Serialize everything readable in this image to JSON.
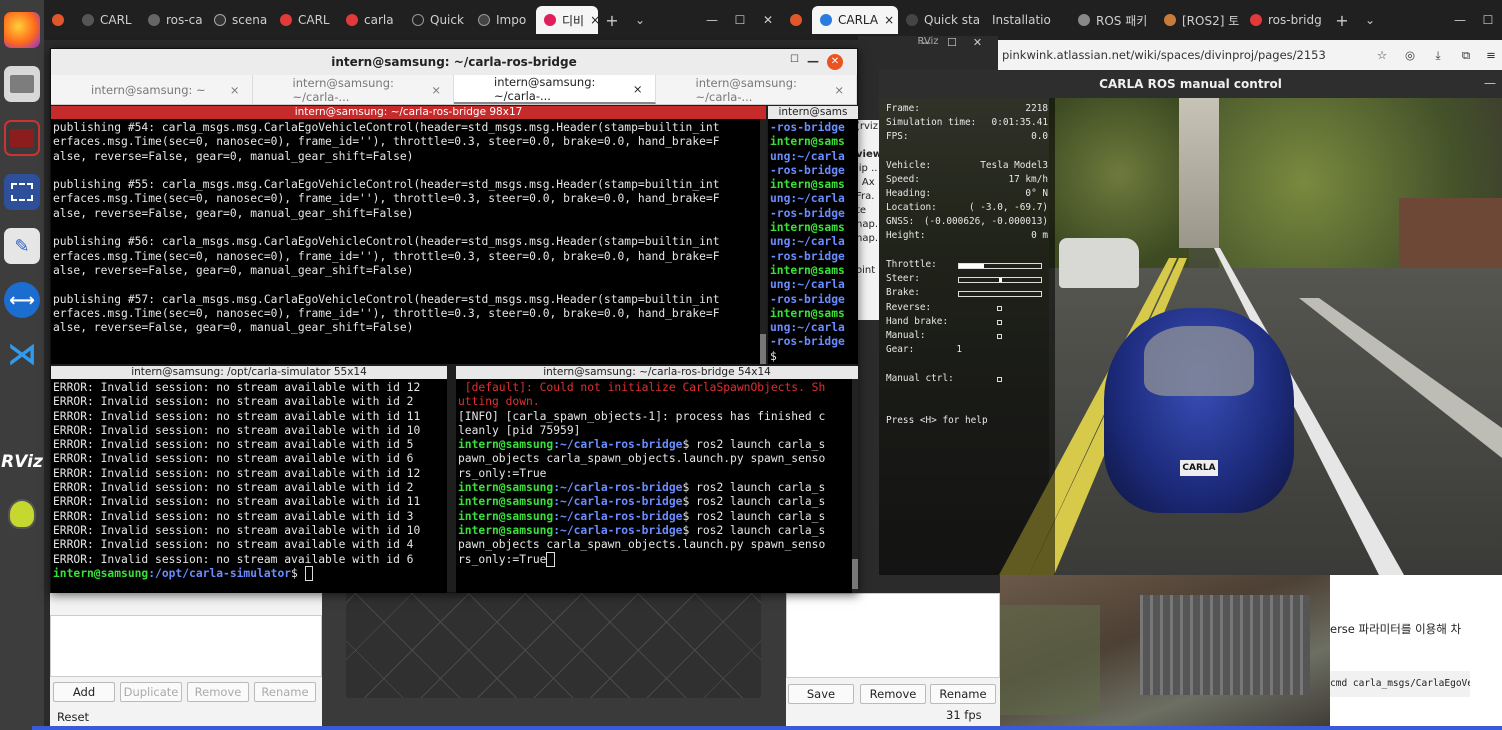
{
  "dock": {
    "items": [
      "firefox-icon",
      "files-icon",
      "terminal-icon",
      "screenshot-icon",
      "text-editor-icon",
      "teamviewer-icon",
      "vscode-icon",
      "rviz-icon",
      "ros-turtle-icon"
    ],
    "rviz_label": "RViz"
  },
  "browser_left": {
    "tabs": [
      "CARL",
      "ros-ca",
      "scena",
      "CARL",
      "carla",
      "Quick",
      "Impo",
      "디비"
    ],
    "add_tab": "+",
    "dropdown": "⌄"
  },
  "browser_right": {
    "tabs": [
      "CARLA",
      "Quick sta",
      "Installatio",
      "ROS 패키",
      "[ROS2] 토",
      "ros-bridg"
    ],
    "add_tab": "+",
    "address": "pinkwink.atlassian.net/wiki/spaces/divinproj/pages/2153",
    "address_host": "pinkwink.atlassian.net",
    "korean_text": "erse 파라미터를 이용해 차",
    "code_snippet": "cmd carla_msgs/CarlaEgoVe"
  },
  "rviz": {
    "title": "RViz",
    "panel_fragments": [
      "(rviz",
      "view",
      "lip ..",
      "' Ax",
      "Fra.",
      "te",
      "hap.",
      "hap.",
      "oint"
    ],
    "buttons_left": {
      "add": "Add",
      "duplicate": "Duplicate",
      "remove": "Remove",
      "rename": "Rename",
      "reset": "Reset"
    },
    "buttons_right": {
      "save": "Save",
      "remove": "Remove",
      "rename": "Rename"
    },
    "fps": "31 fps"
  },
  "terminal": {
    "title": "intern@samsung: ~/carla-ros-bridge",
    "tabs": [
      "intern@samsung: ~",
      "intern@samsung: ~/carla-...",
      "intern@samsung: ~/carla-...",
      "intern@samsung: ~/carla-..."
    ],
    "pane_top_left": {
      "title": "intern@samsung: ~/carla-ros-bridge 98x17",
      "lines": [
        "publishing #54: carla_msgs.msg.CarlaEgoVehicleControl(header=std_msgs.msg.Header(stamp=builtin_int",
        "erfaces.msg.Time(sec=0, nanosec=0), frame_id=''), throttle=0.3, steer=0.0, brake=0.0, hand_brake=F",
        "alse, reverse=False, gear=0, manual_gear_shift=False)",
        "",
        "publishing #55: carla_msgs.msg.CarlaEgoVehicleControl(header=std_msgs.msg.Header(stamp=builtin_int",
        "erfaces.msg.Time(sec=0, nanosec=0), frame_id=''), throttle=0.3, steer=0.0, brake=0.0, hand_brake=F",
        "alse, reverse=False, gear=0, manual_gear_shift=False)",
        "",
        "publishing #56: carla_msgs.msg.CarlaEgoVehicleControl(header=std_msgs.msg.Header(stamp=builtin_int",
        "erfaces.msg.Time(sec=0, nanosec=0), frame_id=''), throttle=0.3, steer=0.0, brake=0.0, hand_brake=F",
        "alse, reverse=False, gear=0, manual_gear_shift=False)",
        "",
        "publishing #57: carla_msgs.msg.CarlaEgoVehicleControl(header=std_msgs.msg.Header(stamp=builtin_int",
        "erfaces.msg.Time(sec=0, nanosec=0), frame_id=''), throttle=0.3, steer=0.0, brake=0.0, hand_brake=F",
        "alse, reverse=False, gear=0, manual_gear_shift=False)"
      ]
    },
    "pane_top_right": {
      "title": "intern@sams",
      "lines": [
        "-ros-bridge",
        "intern@sams",
        "ung:~/carla",
        "-ros-bridge",
        "intern@sams",
        "ung:~/carla",
        "-ros-bridge",
        "intern@sams",
        "ung:~/carla",
        "-ros-bridge",
        "intern@sams",
        "ung:~/carla",
        "-ros-bridge",
        "intern@sams",
        "ung:~/carla",
        "-ros-bridge",
        "$"
      ]
    },
    "pane_bottom_left": {
      "title": "intern@samsung: /opt/carla-simulator 55x14",
      "errors": [
        "ERROR: Invalid session: no stream available with id 12",
        "ERROR: Invalid session: no stream available with id 2",
        "ERROR: Invalid session: no stream available with id 11",
        "ERROR: Invalid session: no stream available with id 10",
        "ERROR: Invalid session: no stream available with id 5",
        "ERROR: Invalid session: no stream available with id 6",
        "ERROR: Invalid session: no stream available with id 12",
        "ERROR: Invalid session: no stream available with id 2",
        "ERROR: Invalid session: no stream available with id 11",
        "ERROR: Invalid session: no stream available with id 3",
        "ERROR: Invalid session: no stream available with id 10",
        "ERROR: Invalid session: no stream available with id 4",
        "ERROR: Invalid session: no stream available with id 6"
      ],
      "prompt_user": "intern@samsung",
      "prompt_path": ":/opt/carla-simulator",
      "prompt_sym": "$ "
    },
    "pane_bottom_right": {
      "title": "intern@samsung: ~/carla-ros-bridge 54x14",
      "red_lines": [
        " [default]: Could not initialize CarlaSpawnObjects. Sh",
        "utting down."
      ],
      "info_lines": [
        "[INFO] [carla_spawn_objects-1]: process has finished c",
        "leanly [pid 75959]"
      ],
      "prompt_user": "intern@samsung",
      "prompt_path": ":~/carla-ros-bridge",
      "commands": [
        {
          "cmd": "$ ros2 launch carla_s",
          "cont": [
            "pawn_objects carla_spawn_objects.launch.py spawn_senso",
            "rs_only:=True"
          ]
        },
        {
          "cmd": "$ ros2 launch carla_s",
          "cont": []
        },
        {
          "cmd": "$ ros2 launch carla_s",
          "cont": []
        },
        {
          "cmd": "$ ros2 launch carla_s",
          "cont": []
        },
        {
          "cmd": "$ ros2 launch carla_s",
          "cont": [
            "pawn_objects carla_spawn_objects.launch.py spawn_senso",
            "rs_only:=True"
          ]
        }
      ]
    }
  },
  "carla": {
    "title": "CARLA ROS manual control",
    "hud": {
      "frame_label": "Frame:",
      "frame": "2218",
      "sim_time_label": "Simulation time:",
      "sim_time": "0:01:35.41",
      "fps_label": "FPS:",
      "fps": "0.0",
      "vehicle_label": "Vehicle:",
      "vehicle": "Tesla Model3",
      "speed_label": "Speed:",
      "speed": "17 km/h",
      "heading_label": "Heading:",
      "heading": "0° N",
      "location_label": "Location:",
      "location": "( -3.0, -69.7)",
      "gnss_label": "GNSS:",
      "gnss": "(-0.000626, -0.000013)",
      "height_label": "Height:",
      "height": "0 m",
      "throttle_label": "Throttle:",
      "throttle": 0.3,
      "steer_label": "Steer:",
      "steer": 0.0,
      "brake_label": "Brake:",
      "brake": 0.0,
      "reverse_label": "Reverse:",
      "hand_brake_label": "Hand brake:",
      "manual_label": "Manual:",
      "gear_label": "Gear:",
      "gear": "1",
      "manual_ctrl_label": "Manual ctrl:",
      "help": "Press <H> for help"
    },
    "plate": "CARLA"
  },
  "colors": {
    "prompt_green": "#3ae03a",
    "prompt_blue": "#6a8cff",
    "error_red": "#e03030",
    "pane_active_red": "#c52b2b"
  }
}
